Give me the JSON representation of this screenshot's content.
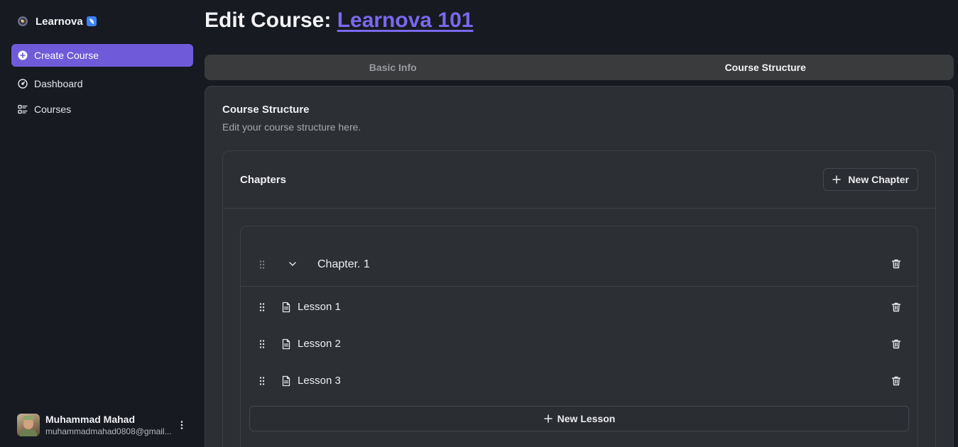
{
  "sidebar": {
    "brand": "Learnova",
    "nav": [
      {
        "label": "Create Course",
        "icon": "plus-circle-icon",
        "active": true
      },
      {
        "label": "Dashboard",
        "icon": "gauge-icon",
        "active": false
      },
      {
        "label": "Courses",
        "icon": "list-icon",
        "active": false
      }
    ],
    "user": {
      "name": "Muhammad Mahad",
      "email": "muhammadmahad0808@gmail..."
    }
  },
  "header": {
    "title_prefix": "Edit Course: ",
    "course_name": "Learnova 101"
  },
  "tabs": [
    {
      "label": "Basic Info",
      "active": false
    },
    {
      "label": "Course Structure",
      "active": true
    }
  ],
  "structure": {
    "title": "Course Structure",
    "description": "Edit your course structure here.",
    "chapters_title": "Chapters",
    "new_chapter_label": "New Chapter",
    "chapter": {
      "name": "Chapter. 1",
      "lessons": [
        {
          "name": "Lesson 1"
        },
        {
          "name": "Lesson 2"
        },
        {
          "name": "Lesson 3"
        }
      ],
      "new_lesson_label": "New Lesson"
    }
  },
  "colors": {
    "accent": "#6f5bd9",
    "link": "#7b68ee",
    "background": "#171a21",
    "card": "#2c2f33"
  }
}
